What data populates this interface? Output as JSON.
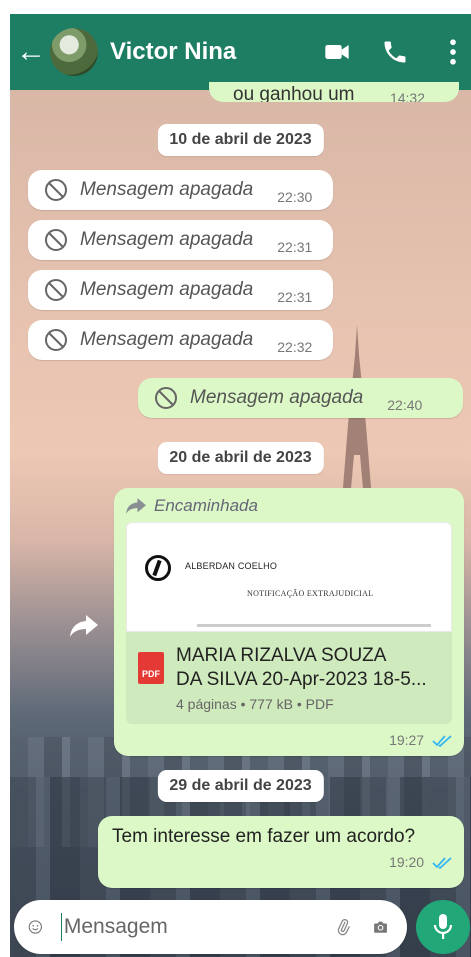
{
  "header": {
    "back_icon": "arrow-left-icon",
    "contact_name": "Victor Nina",
    "icons": [
      "video-call-icon",
      "phone-call-icon",
      "kebab-menu-icon"
    ],
    "bg_color": "#1e7e64"
  },
  "chat": {
    "partial_message": {
      "text": "ou ganhou um",
      "time": "14:32"
    },
    "date_1": "10 de abril de 2023",
    "deleted_messages": [
      {
        "text": "Mensagem apagada",
        "time": "22:30"
      },
      {
        "text": "Mensagem apagada",
        "time": "22:31"
      },
      {
        "text": "Mensagem apagada",
        "time": "22:31"
      },
      {
        "text": "Mensagem apagada",
        "time": "22:32"
      }
    ],
    "deleted_out": {
      "text": "Mensagem apagada",
      "time": "22:40"
    },
    "date_2": "20 de abril de 2023",
    "forwarded": {
      "label": "Encaminhada",
      "preview_firm": "ALBERDAN COELHO",
      "preview_heading": "NOTIFICAÇÃO EXTRAJUDICIAL",
      "pdf_badge": "PDF",
      "file_title_line1": "MARIA RIZALVA SOUZA",
      "file_title_line2": "DA SILVA 20-Apr-2023 18-5...",
      "file_meta": "4 páginas • 777 kB • PDF",
      "time": "19:27"
    },
    "date_3": "29 de abril de 2023",
    "last_message": {
      "text": "Tem interesse em fazer um acordo?",
      "time": "19:20"
    }
  },
  "input": {
    "placeholder": "Mensagem",
    "icons": [
      "emoji-icon",
      "attach-clip-icon",
      "camera-icon",
      "mic-icon"
    ]
  },
  "colors": {
    "outgoing_bubble": "#dcf8c6",
    "incoming_bubble": "#ffffff",
    "read_tick": "#34b7f1",
    "accent": "#22a878"
  }
}
